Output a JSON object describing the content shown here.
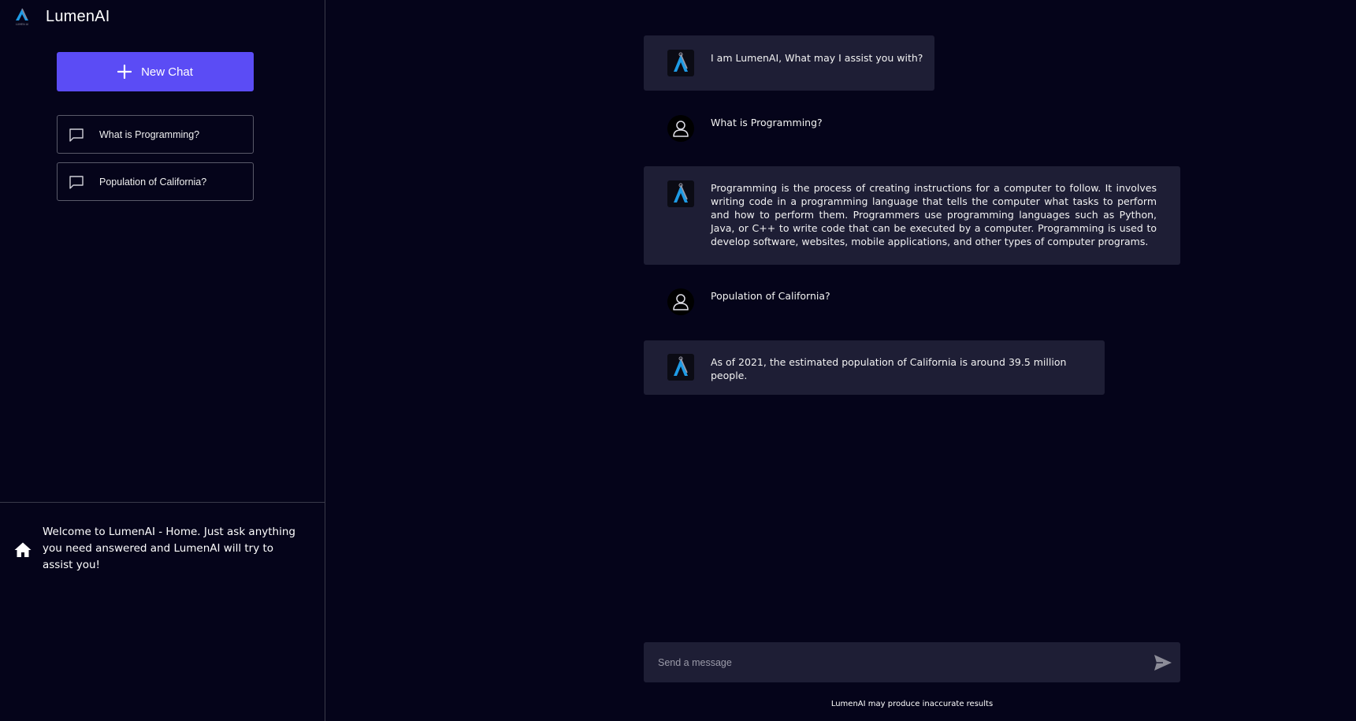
{
  "brand": {
    "name": "LumenAI",
    "logo_caption": "LUMEN AI"
  },
  "sidebar": {
    "new_chat_label": "New Chat",
    "history": [
      {
        "label": "What is Programming?"
      },
      {
        "label": "Population of California?"
      }
    ],
    "welcome_text": "Welcome to LumenAI - Home. Just ask anything you need answered and LumenAI will try to assist you!"
  },
  "chat": {
    "messages": [
      {
        "role": "bot",
        "text": "I am LumenAI, What may I assist you with?"
      },
      {
        "role": "user",
        "text": "What is Programming?"
      },
      {
        "role": "bot",
        "text": "Programming is the process of creating instructions for a computer to follow. It involves writing code in a programming language that tells the computer what tasks to perform and how to perform them. Programmers use programming languages such as Python, Java, or C++ to write code that can be executed by a computer. Programming is used to develop software, websites, mobile applications, and other types of computer programs."
      },
      {
        "role": "user",
        "text": "Population of California?"
      },
      {
        "role": "bot",
        "text": "As of 2021, the estimated population of California is around 39.5 million people."
      }
    ]
  },
  "composer": {
    "placeholder": "Send a message",
    "value": ""
  },
  "disclaimer": "LumenAI may produce inaccurate results",
  "colors": {
    "background": "#05041a",
    "accent": "#5b4cf5",
    "bot_bubble": "#1e1e35",
    "logo_blue": "#1e9be6"
  },
  "icons": {
    "brand": "lumen-logo-icon",
    "new_chat": "plus-icon",
    "history": "chat-bubble-icon",
    "welcome": "home-icon",
    "bot": "lumen-logo-icon",
    "user": "user-icon",
    "send": "send-icon"
  }
}
